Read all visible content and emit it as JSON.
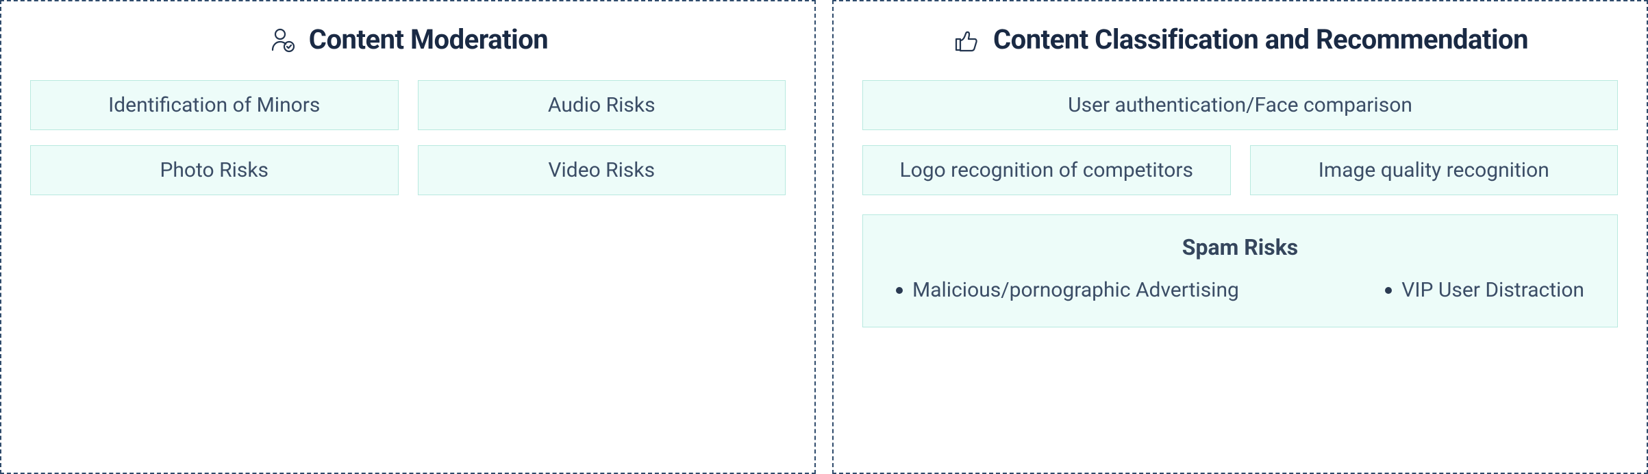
{
  "left": {
    "title": "Content Moderation",
    "items": [
      "Identification of Minors",
      "Audio Risks",
      "Photo Risks",
      "Video Risks"
    ]
  },
  "right": {
    "title": "Content Classification and Recommendation",
    "full_row": "User authentication/Face comparison",
    "half_rows": [
      "Logo recognition of competitors",
      "Image quality recognition"
    ],
    "spam": {
      "title": "Spam Risks",
      "bullets": [
        "Malicious/pornographic Advertising",
        "VIP User Distraction"
      ]
    }
  }
}
